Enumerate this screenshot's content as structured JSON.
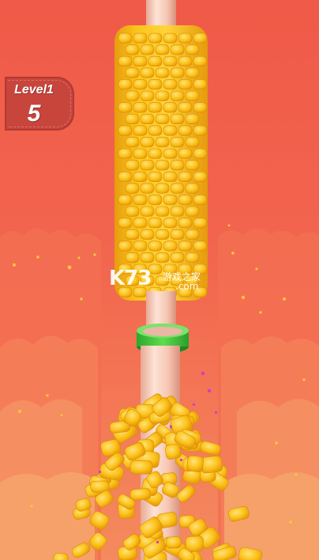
{
  "hud": {
    "level_title": "Level1",
    "level_number": "5"
  },
  "watermark": {
    "main": "K73",
    "sub": "游戏之家",
    "domain": ".com"
  },
  "colors": {
    "background": "#f0604a",
    "corn": "#f9c21c",
    "rod": "#f7c9b6",
    "ring": "#3cbf3a",
    "badge": "#c8453c"
  }
}
